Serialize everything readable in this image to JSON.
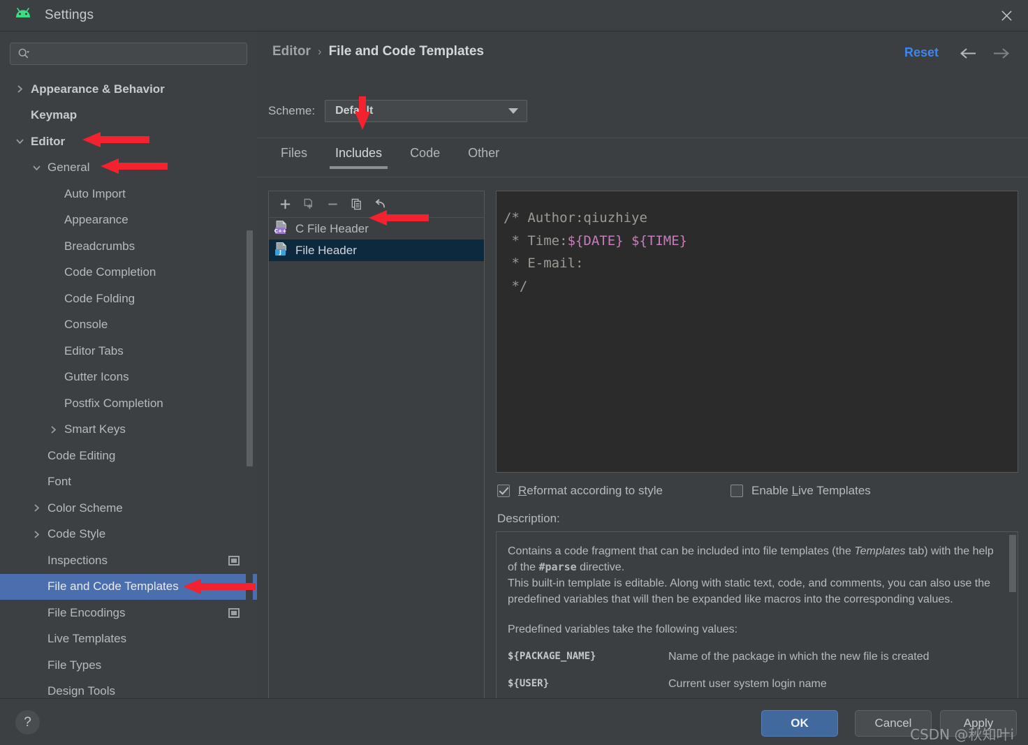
{
  "window": {
    "title": "Settings",
    "logo_icon": "android-logo-icon",
    "close_icon": "close-icon"
  },
  "sidebar": {
    "search": {
      "placeholder": "",
      "value": "",
      "icon": "search-icon"
    },
    "items": [
      {
        "label": "Appearance & Behavior",
        "indent": 0,
        "arrow": "collapsed",
        "bold": true,
        "selected": false,
        "scope_icon": false
      },
      {
        "label": "Keymap",
        "indent": 0,
        "arrow": "none",
        "bold": true,
        "selected": false,
        "scope_icon": false
      },
      {
        "label": "Editor",
        "indent": 0,
        "arrow": "expanded",
        "bold": true,
        "selected": false,
        "scope_icon": false
      },
      {
        "label": "General",
        "indent": 1,
        "arrow": "expanded",
        "bold": false,
        "selected": false,
        "scope_icon": false
      },
      {
        "label": "Auto Import",
        "indent": 2,
        "arrow": "none",
        "bold": false,
        "selected": false,
        "scope_icon": false
      },
      {
        "label": "Appearance",
        "indent": 2,
        "arrow": "none",
        "bold": false,
        "selected": false,
        "scope_icon": false
      },
      {
        "label": "Breadcrumbs",
        "indent": 2,
        "arrow": "none",
        "bold": false,
        "selected": false,
        "scope_icon": false
      },
      {
        "label": "Code Completion",
        "indent": 2,
        "arrow": "none",
        "bold": false,
        "selected": false,
        "scope_icon": false
      },
      {
        "label": "Code Folding",
        "indent": 2,
        "arrow": "none",
        "bold": false,
        "selected": false,
        "scope_icon": false
      },
      {
        "label": "Console",
        "indent": 2,
        "arrow": "none",
        "bold": false,
        "selected": false,
        "scope_icon": false
      },
      {
        "label": "Editor Tabs",
        "indent": 2,
        "arrow": "none",
        "bold": false,
        "selected": false,
        "scope_icon": false
      },
      {
        "label": "Gutter Icons",
        "indent": 2,
        "arrow": "none",
        "bold": false,
        "selected": false,
        "scope_icon": false
      },
      {
        "label": "Postfix Completion",
        "indent": 2,
        "arrow": "none",
        "bold": false,
        "selected": false,
        "scope_icon": false
      },
      {
        "label": "Smart Keys",
        "indent": 2,
        "arrow": "collapsed",
        "bold": false,
        "selected": false,
        "scope_icon": false
      },
      {
        "label": "Code Editing",
        "indent": 1,
        "arrow": "none",
        "bold": false,
        "selected": false,
        "scope_icon": false
      },
      {
        "label": "Font",
        "indent": 1,
        "arrow": "none",
        "bold": false,
        "selected": false,
        "scope_icon": false
      },
      {
        "label": "Color Scheme",
        "indent": 1,
        "arrow": "collapsed",
        "bold": false,
        "selected": false,
        "scope_icon": false
      },
      {
        "label": "Code Style",
        "indent": 1,
        "arrow": "collapsed",
        "bold": false,
        "selected": false,
        "scope_icon": false
      },
      {
        "label": "Inspections",
        "indent": 1,
        "arrow": "none",
        "bold": false,
        "selected": false,
        "scope_icon": true
      },
      {
        "label": "File and Code Templates",
        "indent": 1,
        "arrow": "none",
        "bold": false,
        "selected": true,
        "scope_icon": false
      },
      {
        "label": "File Encodings",
        "indent": 1,
        "arrow": "none",
        "bold": false,
        "selected": false,
        "scope_icon": true
      },
      {
        "label": "Live Templates",
        "indent": 1,
        "arrow": "none",
        "bold": false,
        "selected": false,
        "scope_icon": false
      },
      {
        "label": "File Types",
        "indent": 1,
        "arrow": "none",
        "bold": false,
        "selected": false,
        "scope_icon": false
      },
      {
        "label": "Design Tools",
        "indent": 1,
        "arrow": "none",
        "bold": false,
        "selected": false,
        "scope_icon": false
      }
    ]
  },
  "header": {
    "breadcrumb_root": "Editor",
    "breadcrumb_separator": "›",
    "breadcrumb_leaf": "File and Code Templates",
    "reset_label": "Reset",
    "nav_back_icon": "arrow-left-icon",
    "nav_forward_icon": "arrow-right-icon"
  },
  "scheme": {
    "label": "Scheme:",
    "value": "Default",
    "caret_icon": "chevron-down-icon"
  },
  "tabs": [
    {
      "label": "Files",
      "active": false
    },
    {
      "label": "Includes",
      "active": true
    },
    {
      "label": "Code",
      "active": false
    },
    {
      "label": "Other",
      "active": false
    }
  ],
  "list_toolbar": [
    {
      "name": "add-template-button",
      "icon": "plus-icon"
    },
    {
      "name": "create-child-button",
      "icon": "copy-template-icon"
    },
    {
      "name": "remove-template-button",
      "icon": "minus-icon"
    },
    {
      "name": "copy-template-button",
      "icon": "copy-icon"
    },
    {
      "name": "reset-template-button",
      "icon": "revert-icon"
    }
  ],
  "templates": [
    {
      "label": "C File Header",
      "badge": "C++",
      "badge_color": "#9876c8",
      "selected": false
    },
    {
      "label": "File Header",
      "badge": "J",
      "badge_color": "#3c9fd6",
      "selected": true
    }
  ],
  "editor": {
    "lines": [
      {
        "segments": [
          {
            "t": "/* Author:qiuzhiye",
            "v": false
          }
        ]
      },
      {
        "segments": [
          {
            "t": " * Time:",
            "v": false
          },
          {
            "t": "${DATE}",
            "v": true
          },
          {
            "t": " ",
            "v": false
          },
          {
            "t": "${TIME}",
            "v": true
          }
        ]
      },
      {
        "segments": [
          {
            "t": " * E-mail:",
            "v": false
          }
        ]
      },
      {
        "segments": [
          {
            "t": " */",
            "v": false
          }
        ]
      }
    ]
  },
  "options": {
    "reformat": {
      "label_before": "",
      "mnemonic": "R",
      "label_after": "eformat according to style",
      "checked": true
    },
    "live_templates": {
      "label_before": "Enable ",
      "mnemonic": "L",
      "label_after": "ive Templates",
      "checked": false
    }
  },
  "description": {
    "title": "Description:",
    "para1_a": "Contains a code fragment that can be included into file templates (the ",
    "para1_italic": "Templates",
    "para1_b": " tab) with the help of the ",
    "para1_bold": "#parse",
    "para1_c": " directive.",
    "para2": "This built-in template is editable. Along with static text, code, and comments, you can also use the predefined variables that will then be expanded like macros into the corresponding values.",
    "vars_intro": "Predefined variables take the following values:",
    "vars": [
      {
        "name": "${PACKAGE_NAME}",
        "desc": "Name of the package in which the new file is created"
      },
      {
        "name": "${USER}",
        "desc": "Current user system login name"
      }
    ]
  },
  "footer": {
    "help_label": "?",
    "ok_label": "OK",
    "cancel_label": "Cancel",
    "apply_label": "Apply",
    "watermark": "CSDN @秋知叶i"
  },
  "annotations": {
    "color": "#f4212e",
    "arrows": [
      {
        "name": "arrow-to-editor-item",
        "direction": "left"
      },
      {
        "name": "arrow-to-general-item",
        "direction": "left"
      },
      {
        "name": "arrow-to-includes-tab",
        "direction": "down"
      },
      {
        "name": "arrow-to-file-header-item",
        "direction": "left"
      },
      {
        "name": "arrow-to-templates-item",
        "direction": "left"
      }
    ]
  }
}
